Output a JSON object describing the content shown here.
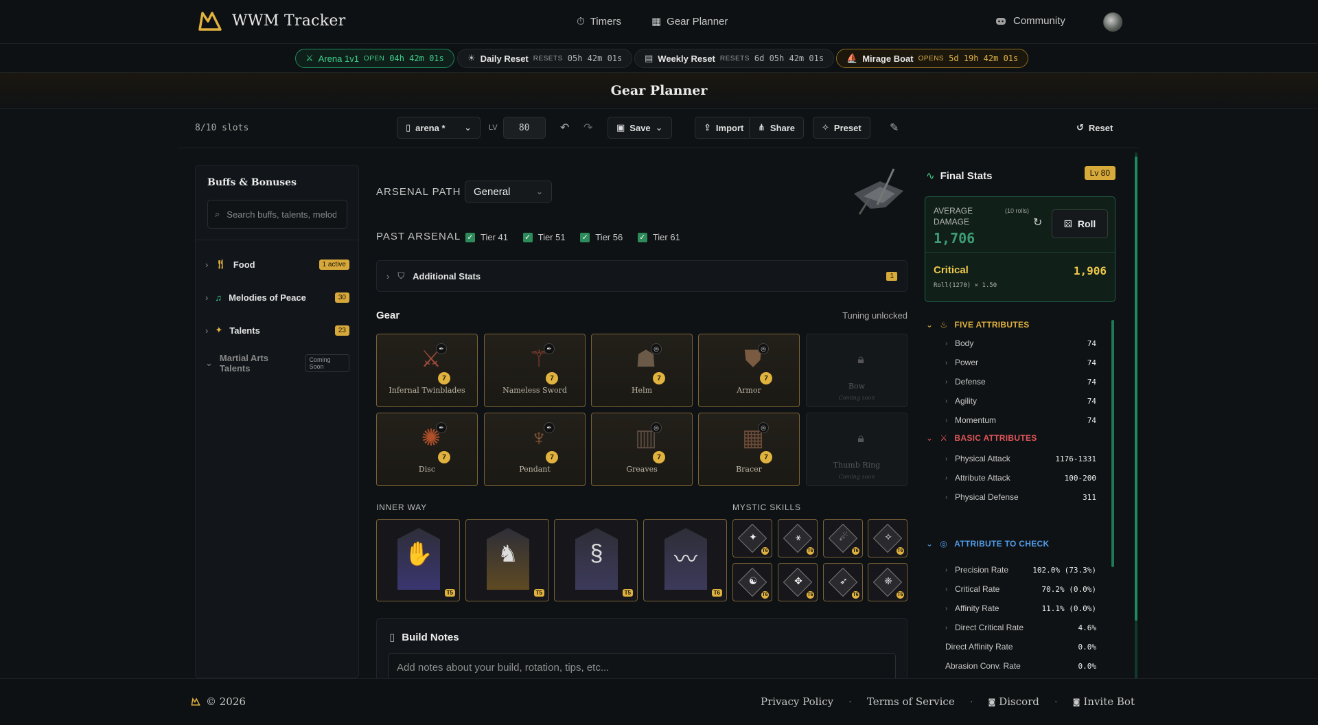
{
  "app": {
    "title": "WWM Tracker"
  },
  "nav": {
    "timers": "Timers",
    "gear_planner": "Gear Planner",
    "community": "Community"
  },
  "timers": [
    {
      "name": "Arena 1v1",
      "status": "OPEN",
      "time": "04h 42m 01s"
    },
    {
      "name": "Daily Reset",
      "status": "RESETS",
      "time": "05h 42m 01s"
    },
    {
      "name": "Weekly Reset",
      "status": "RESETS",
      "time": "6d 05h 42m 01s"
    },
    {
      "name": "Mirage Boat",
      "status": "OPENS",
      "time": "5d 19h 42m 01s"
    }
  ],
  "page": {
    "title": "Gear Planner"
  },
  "toolbar": {
    "slots": "8/10 slots",
    "build_name": "arena *",
    "level_label": "LV",
    "level_value": "80",
    "save": "Save",
    "import": "Import",
    "share": "Share",
    "preset": "Preset",
    "reset": "Reset"
  },
  "sidebar": {
    "title": "Buffs & Bonuses",
    "search_placeholder": "Search buffs, talents, melodies...",
    "items": [
      {
        "label": "Food",
        "badge": "1 active"
      },
      {
        "label": "Melodies of Peace",
        "badge": "30"
      },
      {
        "label": "Talents",
        "badge": "23"
      },
      {
        "label": "Martial Arts Talents",
        "badge": "Coming Soon"
      }
    ]
  },
  "arsenal": {
    "path_label": "ARSENAL PATH",
    "path_value": "General",
    "past_label": "PAST ARSENAL",
    "tiers": [
      "Tier 41",
      "Tier 51",
      "Tier 56",
      "Tier 61"
    ],
    "additional_stats": "Additional Stats",
    "additional_count": "1"
  },
  "gear": {
    "title": "Gear",
    "tuning": "Tuning unlocked",
    "coming_soon": "Coming soon",
    "slots": [
      {
        "name": "Infernal Twinblades",
        "level": "7"
      },
      {
        "name": "Nameless Sword",
        "level": "7"
      },
      {
        "name": "Helm",
        "level": "7"
      },
      {
        "name": "Armor",
        "level": "7"
      },
      {
        "name": "Bow",
        "level": ""
      },
      {
        "name": "Disc",
        "level": "7"
      },
      {
        "name": "Pendant",
        "level": "7"
      },
      {
        "name": "Greaves",
        "level": "7"
      },
      {
        "name": "Bracer",
        "level": "7"
      },
      {
        "name": "Thumb Ring",
        "level": ""
      }
    ]
  },
  "inner_way": {
    "title": "INNER WAY",
    "tiers": [
      "T5",
      "T5",
      "T5",
      "T6"
    ]
  },
  "mystic": {
    "title": "MYSTIC SKILLS",
    "tiers": [
      "T6",
      "T6",
      "T6",
      "T6",
      "T6",
      "T6",
      "T6",
      "T6"
    ]
  },
  "notes": {
    "title": "Build Notes",
    "placeholder": "Add notes about your build, rotation, tips, etc..."
  },
  "stats": {
    "title": "Final Stats",
    "level": "Lv 80",
    "avg_label": "AVERAGE DAMAGE",
    "rolls": "(10 rolls)",
    "avg_value": "1,706",
    "roll_btn": "Roll",
    "crit_label": "Critical",
    "crit_value": "1,906",
    "crit_formula": "Roll(1270) × 1.50",
    "five_title": "FIVE ATTRIBUTES",
    "five": [
      {
        "name": "Body",
        "value": "74"
      },
      {
        "name": "Power",
        "value": "74"
      },
      {
        "name": "Defense",
        "value": "74"
      },
      {
        "name": "Agility",
        "value": "74"
      },
      {
        "name": "Momentum",
        "value": "74"
      }
    ],
    "basic_title": "BASIC ATTRIBUTES",
    "basic": [
      {
        "name": "Physical Attack",
        "value": "1176-1331"
      },
      {
        "name": "Attribute Attack",
        "value": "100-200"
      },
      {
        "name": "Physical Defense",
        "value": "311"
      }
    ],
    "check_title": "ATTRIBUTE TO CHECK",
    "check": [
      {
        "name": "Precision Rate",
        "value": "102.0% (73.3%)"
      },
      {
        "name": "Critical Rate",
        "value": "70.2% (0.0%)"
      },
      {
        "name": "Affinity Rate",
        "value": "11.1% (0.0%)"
      },
      {
        "name": "Direct Critical Rate",
        "value": "4.6%"
      },
      {
        "name": "Direct Affinity Rate",
        "value": "0.0%"
      },
      {
        "name": "Abrasion Conv. Rate",
        "value": "0.0%"
      }
    ]
  },
  "footer": {
    "copyright": "© 2026",
    "privacy": "Privacy Policy",
    "terms": "Terms of Service",
    "discord": "Discord",
    "invite": "Invite Bot"
  },
  "colors": {
    "accent": "#e0b23e",
    "green": "#3fd18d",
    "red": "#e0555a",
    "blue": "#4f9be8"
  }
}
